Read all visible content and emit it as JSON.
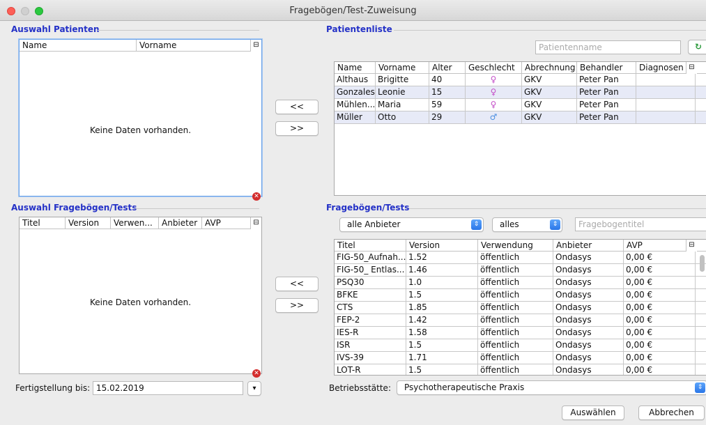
{
  "window": {
    "title": "Fragebögen/Test-Zuweisung"
  },
  "left_patients": {
    "title": "Auswahl Patienten",
    "columns": [
      "Name",
      "Vorname"
    ],
    "empty_text": "Keine Daten vorhanden."
  },
  "left_tests": {
    "title": "Auswahl Fragebögen/Tests",
    "columns": [
      "Titel",
      "Version",
      "Verwen...",
      "Anbieter",
      "AVP"
    ],
    "empty_text": "Keine Daten vorhanden."
  },
  "transfer_buttons": {
    "add_label": "<<",
    "remove_label": ">>"
  },
  "patient_list": {
    "title": "Patientenliste",
    "search_placeholder": "Patientenname",
    "columns": [
      "Name",
      "Vorname",
      "Alter",
      "Geschlecht",
      "Abrechnung",
      "Behandler",
      "Diagnosen"
    ],
    "rows": [
      {
        "name": "Althaus",
        "vorname": "Brigitte",
        "alter": "40",
        "geschlecht": "female",
        "abrechnung": "GKV",
        "behandler": "Peter Pan",
        "diagnosen": ""
      },
      {
        "name": "Gonzales",
        "vorname": "Leonie",
        "alter": "15",
        "geschlecht": "female",
        "abrechnung": "GKV",
        "behandler": "Peter Pan",
        "diagnosen": ""
      },
      {
        "name": "Mühlen...",
        "vorname": "Maria",
        "alter": "59",
        "geschlecht": "female",
        "abrechnung": "GKV",
        "behandler": "Peter Pan",
        "diagnosen": ""
      },
      {
        "name": "Müller",
        "vorname": "Otto",
        "alter": "29",
        "geschlecht": "male",
        "abrechnung": "GKV",
        "behandler": "Peter Pan",
        "diagnosen": ""
      }
    ]
  },
  "tests_list": {
    "title": "Fragebögen/Tests",
    "provider_select": "alle Anbieter",
    "filter_select": "alles",
    "title_placeholder": "Fragebogentitel",
    "columns": [
      "Titel",
      "Version",
      "Verwendung",
      "Anbieter",
      "AVP"
    ],
    "rows": [
      {
        "titel": "FIG-50_Aufnah...",
        "version": "1.52",
        "verwendung": "öffentlich",
        "anbieter": "Ondasys",
        "avp": "0,00 €"
      },
      {
        "titel": "FIG-50_ Entlas...",
        "version": "1.46",
        "verwendung": "öffentlich",
        "anbieter": "Ondasys",
        "avp": "0,00 €"
      },
      {
        "titel": "PSQ30",
        "version": "1.0",
        "verwendung": "öffentlich",
        "anbieter": "Ondasys",
        "avp": "0,00 €"
      },
      {
        "titel": "BFKE",
        "version": "1.5",
        "verwendung": "öffentlich",
        "anbieter": "Ondasys",
        "avp": "0,00 €"
      },
      {
        "titel": "CTS",
        "version": "1.85",
        "verwendung": "öffentlich",
        "anbieter": "Ondasys",
        "avp": "0,00 €"
      },
      {
        "titel": "FEP-2",
        "version": "1.42",
        "verwendung": "öffentlich",
        "anbieter": "Ondasys",
        "avp": "0,00 €"
      },
      {
        "titel": "IES-R",
        "version": "1.58",
        "verwendung": "öffentlich",
        "anbieter": "Ondasys",
        "avp": "0,00 €"
      },
      {
        "titel": "ISR",
        "version": "1.5",
        "verwendung": "öffentlich",
        "anbieter": "Ondasys",
        "avp": "0,00 €"
      },
      {
        "titel": "IVS-39",
        "version": "1.71",
        "verwendung": "öffentlich",
        "anbieter": "Ondasys",
        "avp": "0,00 €"
      },
      {
        "titel": "LOT-R",
        "version": "1.5",
        "verwendung": "öffentlich",
        "anbieter": "Ondasys",
        "avp": "0,00 €"
      }
    ]
  },
  "footer": {
    "completion_label": "Fertigstellung bis:",
    "completion_date": "15.02.2019",
    "site_label": "Betriebsstätte:",
    "site_value": "Psychotherapeutische Praxis",
    "select_button": "Auswählen",
    "cancel_button": "Abbrechen"
  },
  "icons": {
    "female": "♀",
    "male": "♂",
    "refresh": "↻",
    "error": "✕",
    "column_menu": "⊟",
    "select_arrows": "⇕",
    "dropdown": "▾"
  },
  "colors": {
    "section_title": "#2431c7",
    "row_alt": "#e7eaf7",
    "error": "#d32d2d",
    "select_accent": "#2a76e8"
  }
}
